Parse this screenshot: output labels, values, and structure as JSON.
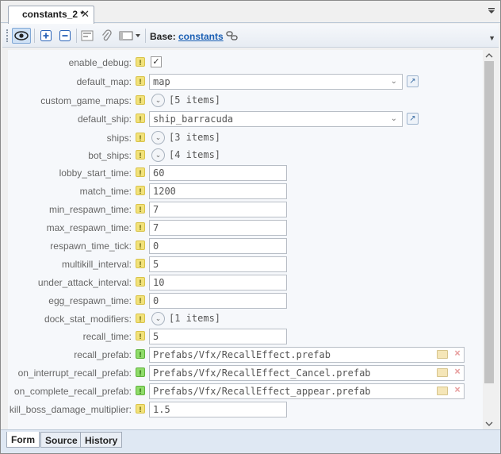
{
  "tab": {
    "title": "constants_2 *",
    "close": "✕"
  },
  "toolbar": {
    "base_label": "Base:",
    "base_link": "constants"
  },
  "fields": [
    {
      "label": "enable_debug:",
      "flag": "!",
      "type": "checkbox",
      "checked": true,
      "value": "✓"
    },
    {
      "label": "default_map:",
      "flag": "!",
      "type": "select",
      "value": "map"
    },
    {
      "label": "custom_game_maps:",
      "flag": "!",
      "type": "list",
      "value": "[5 items]"
    },
    {
      "label": "default_ship:",
      "flag": "!",
      "type": "select",
      "value": "ship_barracuda"
    },
    {
      "label": "ships:",
      "flag": "!",
      "type": "list",
      "value": "[3 items]"
    },
    {
      "label": "bot_ships:",
      "flag": "!",
      "type": "list",
      "value": "[4 items]"
    },
    {
      "label": "lobby_start_time:",
      "flag": "!",
      "type": "text",
      "value": "60"
    },
    {
      "label": "match_time:",
      "flag": "!",
      "type": "text",
      "value": "1200"
    },
    {
      "label": "min_respawn_time:",
      "flag": "!",
      "type": "text",
      "value": "7"
    },
    {
      "label": "max_respawn_time:",
      "flag": "!",
      "type": "text",
      "value": "7"
    },
    {
      "label": "respawn_time_tick:",
      "flag": "!",
      "type": "text",
      "value": "0"
    },
    {
      "label": "multikill_interval:",
      "flag": "!",
      "type": "text",
      "value": "5"
    },
    {
      "label": "under_attack_interval:",
      "flag": "!",
      "type": "text",
      "value": "10"
    },
    {
      "label": "egg_respawn_time:",
      "flag": "!",
      "type": "text",
      "value": "0"
    },
    {
      "label": "dock_stat_modifiers:",
      "flag": "!",
      "type": "list",
      "value": "[1 items]"
    },
    {
      "label": "recall_time:",
      "flag": "!",
      "type": "text",
      "value": "5"
    },
    {
      "label": "recall_prefab:",
      "flag": "!",
      "type": "path",
      "value": "Prefabs/Vfx/RecallEffect.prefab"
    },
    {
      "label": "on_interrupt_recall_prefab:",
      "flag": "!",
      "type": "path",
      "value": "Prefabs/Vfx/RecallEffect_Cancel.prefab"
    },
    {
      "label": "on_complete_recall_prefab:",
      "flag": "!",
      "type": "path",
      "value": "Prefabs/Vfx/RecallEffect_appear.prefab"
    },
    {
      "label": "kill_boss_damage_multiplier:",
      "flag": "!",
      "type": "text",
      "value": "1.5"
    }
  ],
  "bottom_tabs": [
    "Form",
    "Source",
    "History"
  ],
  "colors": {
    "accent": "#1a5fb4",
    "flag_yellow": "#f2e27a",
    "flag_green": "#8fdc6a"
  }
}
